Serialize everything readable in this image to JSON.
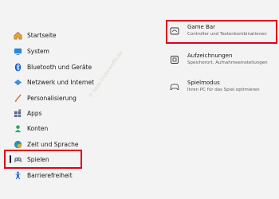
{
  "nav": {
    "items": [
      {
        "label": "Startseite",
        "icon": "home-icon"
      },
      {
        "label": "System",
        "icon": "monitor-icon"
      },
      {
        "label": "Bluetooth und Geräte",
        "icon": "bluetooth-icon"
      },
      {
        "label": "Netzwerk und Internet",
        "icon": "wifi-diamond-icon"
      },
      {
        "label": "Personalisierung",
        "icon": "brush-icon"
      },
      {
        "label": "Apps",
        "icon": "apps-icon"
      },
      {
        "label": "Konten",
        "icon": "person-icon"
      },
      {
        "label": "Zeit und Sprache",
        "icon": "globe-clock-icon"
      },
      {
        "label": "Spielen",
        "icon": "gamepad-icon",
        "active": true
      },
      {
        "label": "Barrierefreiheit",
        "icon": "accessibility-icon"
      }
    ]
  },
  "gaming": {
    "items": [
      {
        "title": "Game Bar",
        "subtitle": "Controller und Tastenkombinationen",
        "icon": "game-bar-icon"
      },
      {
        "title": "Aufzeichnungen",
        "subtitle": "Speicherort, Aufnahmeeinstellungen",
        "icon": "capture-icon"
      },
      {
        "title": "Spielmodus",
        "subtitle": "Ihren PC für das Spiel optimieren",
        "icon": "game-mode-icon"
      }
    ]
  },
  "watermark": "© tipps-tricks-kniffe.de",
  "colors": {
    "highlight": "#e0001b",
    "accent": "#0067c0"
  }
}
